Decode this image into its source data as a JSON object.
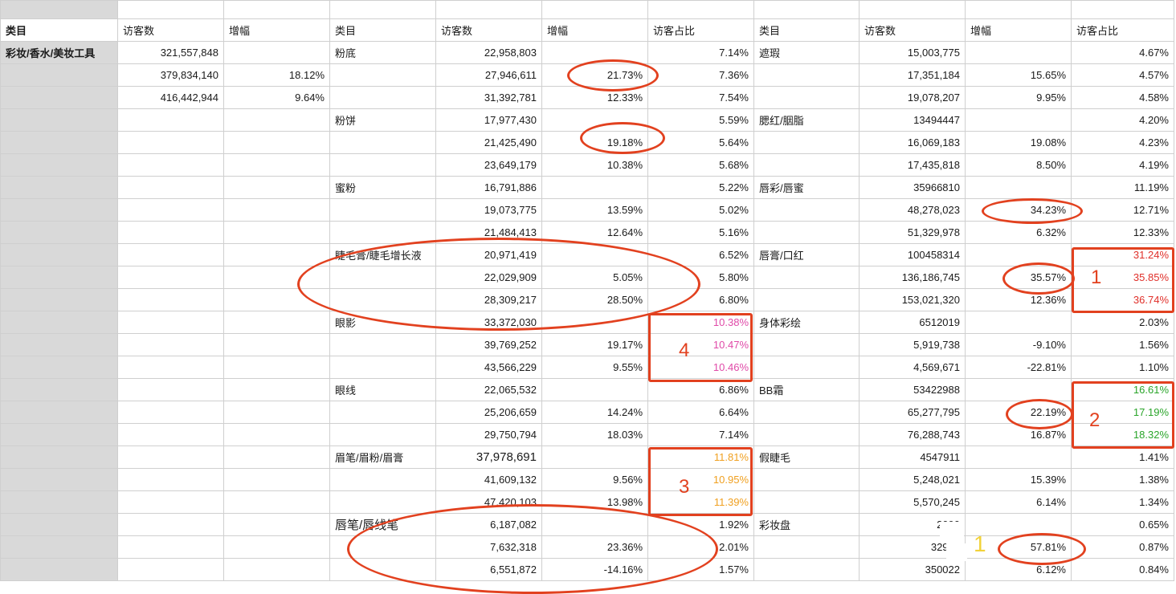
{
  "sheet": {
    "columns": [
      "A",
      "B",
      "C",
      "D",
      "E",
      "F",
      "G",
      "H",
      "I",
      "J",
      "K"
    ],
    "header": [
      "类目",
      "访客数",
      "增幅",
      "类目",
      "访客数",
      "增幅",
      "访客占比",
      "类目",
      "访客数",
      "增幅",
      "访客占比"
    ],
    "rows": [
      [
        "彩妆/香水/美妆工具",
        "321,557,848",
        "",
        "粉底",
        "22,958,803",
        "",
        "7.14%",
        "遮瑕",
        "15,003,775",
        "",
        "4.67%"
      ],
      [
        "",
        "379,834,140",
        "18.12%",
        "",
        "27,946,611",
        "21.73%",
        "7.36%",
        "",
        "17,351,184",
        "15.65%",
        "4.57%"
      ],
      [
        "",
        "416,442,944",
        "9.64%",
        "",
        "31,392,781",
        "12.33%",
        "7.54%",
        "",
        "19,078,207",
        "9.95%",
        "4.58%"
      ],
      [
        "",
        "",
        "",
        "粉饼",
        "17,977,430",
        "",
        "5.59%",
        "腮红/胭脂",
        "13494447",
        "",
        "4.20%"
      ],
      [
        "",
        "",
        "",
        "",
        "21,425,490",
        "19.18%",
        "5.64%",
        "",
        "16,069,183",
        "19.08%",
        "4.23%"
      ],
      [
        "",
        "",
        "",
        "",
        "23,649,179",
        "10.38%",
        "5.68%",
        "",
        "17,435,818",
        "8.50%",
        "4.19%"
      ],
      [
        "",
        "",
        "",
        "蜜粉",
        "16,791,886",
        "",
        "5.22%",
        "唇彩/唇蜜",
        "35966810",
        "",
        "11.19%"
      ],
      [
        "",
        "",
        "",
        "",
        "19,073,775",
        "13.59%",
        "5.02%",
        "",
        "48,278,023",
        "34.23%",
        "12.71%"
      ],
      [
        "",
        "",
        "",
        "",
        "21,484,413",
        "12.64%",
        "5.16%",
        "",
        "51,329,978",
        "6.32%",
        "12.33%"
      ],
      [
        "",
        "",
        "",
        "睫毛膏/睫毛增长液",
        "20,971,419",
        "",
        "6.52%",
        "唇膏/口红",
        "100458314",
        "",
        "31.24%"
      ],
      [
        "",
        "",
        "",
        "",
        "22,029,909",
        "5.05%",
        "5.80%",
        "",
        "136,186,745",
        "35.57%",
        "35.85%"
      ],
      [
        "",
        "",
        "",
        "",
        "28,309,217",
        "28.50%",
        "6.80%",
        "",
        "153,021,320",
        "12.36%",
        "36.74%"
      ],
      [
        "",
        "",
        "",
        "眼影",
        "33,372,030",
        "",
        "10.38%",
        "身体彩绘",
        "6512019",
        "",
        "2.03%"
      ],
      [
        "",
        "",
        "",
        "",
        "39,769,252",
        "19.17%",
        "10.47%",
        "",
        "5,919,738",
        "-9.10%",
        "1.56%"
      ],
      [
        "",
        "",
        "",
        "",
        "43,566,229",
        "9.55%",
        "10.46%",
        "",
        "4,569,671",
        "-22.81%",
        "1.10%"
      ],
      [
        "",
        "",
        "",
        "眼线",
        "22,065,532",
        "",
        "6.86%",
        "BB霜",
        "53422988",
        "",
        "16.61%"
      ],
      [
        "",
        "",
        "",
        "",
        "25,206,659",
        "14.24%",
        "6.64%",
        "",
        "65,277,795",
        "22.19%",
        "17.19%"
      ],
      [
        "",
        "",
        "",
        "",
        "29,750,794",
        "18.03%",
        "7.14%",
        "",
        "76,288,743",
        "16.87%",
        "18.32%"
      ],
      [
        "",
        "",
        "",
        "眉笔/眉粉/眉膏",
        "37,978,691",
        "",
        "11.81%",
        "假睫毛",
        "4547911",
        "",
        "1.41%"
      ],
      [
        "",
        "",
        "",
        "",
        "41,609,132",
        "9.56%",
        "10.95%",
        "",
        "5,248,021",
        "15.39%",
        "1.38%"
      ],
      [
        "",
        "",
        "",
        "",
        "47,420,103",
        "13.98%",
        "11.39%",
        "",
        "5,570,245",
        "6.14%",
        "1.34%"
      ],
      [
        "",
        "",
        "",
        "唇笔/唇线笔",
        "6,187,082",
        "",
        "1.92%",
        "彩妆盘",
        "2090",
        "",
        "0.65%"
      ],
      [
        "",
        "",
        "",
        "",
        "7,632,318",
        "23.36%",
        "2.01%",
        "",
        "32984",
        "57.81%",
        "0.87%"
      ],
      [
        "",
        "",
        "",
        "",
        "6,551,872",
        "-14.16%",
        "1.57%",
        "",
        "350022",
        "6.12%",
        "0.84%"
      ]
    ]
  },
  "annotations": {
    "labels": [
      "1",
      "2",
      "3",
      "4",
      "1"
    ],
    "colors": {
      "stroke": "#e2411f",
      "lipstick_share": "#e0302a",
      "bb_share": "#2aa52a",
      "brow_share": "#f0a020",
      "eyeshadow_share": "#e04aa8",
      "palette_marker": "#f2d23a"
    }
  }
}
